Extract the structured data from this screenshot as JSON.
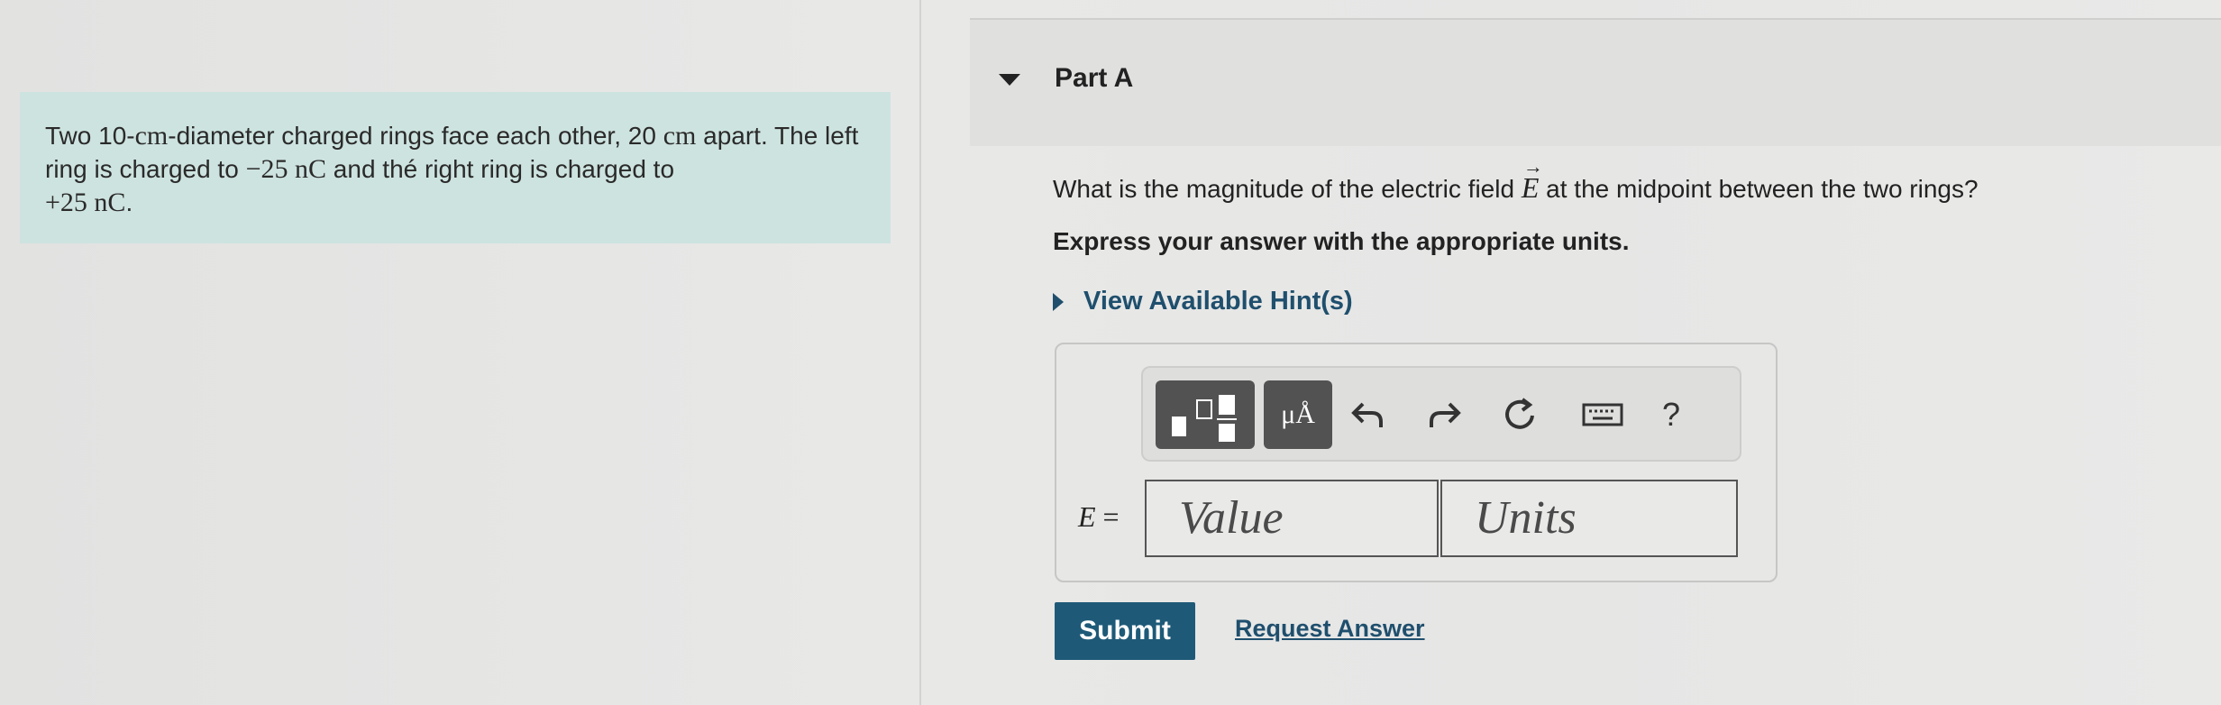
{
  "problem": {
    "text_1": "Two 10-",
    "math_cm_1": "cm",
    "text_2": "-diameter charged rings face each other, 20 ",
    "math_cm_2": "cm",
    "text_3": " apart. The left ring is charged to ",
    "math_charge_left": "−25 nC",
    "text_4": " and thé right ring is charged to ",
    "math_charge_right": "+25 nC",
    "text_5": "."
  },
  "part": {
    "title": "Part A"
  },
  "question": {
    "before": "What is the magnitude of the electric field ",
    "symbol": "E",
    "after": " at the midpoint between the two rings?"
  },
  "instruction": "Express your answer with the appropriate units.",
  "hint": {
    "label": "View Available Hint(s)"
  },
  "toolbar": {
    "units_label": "μÅ",
    "undo_icon": "undo-icon",
    "redo_icon": "redo-icon",
    "reset_icon": "reset-icon",
    "keyboard_icon": "keyboard-icon",
    "help_label": "?"
  },
  "answer": {
    "variable": "E",
    "equals": " =",
    "value_placeholder": "Value",
    "units_placeholder": "Units"
  },
  "actions": {
    "submit_label": "Submit",
    "request_label": "Request Answer"
  },
  "colors": {
    "problem_bg": "#cde3df",
    "link": "#1f4f6d",
    "submit_bg": "#1e5a78"
  }
}
